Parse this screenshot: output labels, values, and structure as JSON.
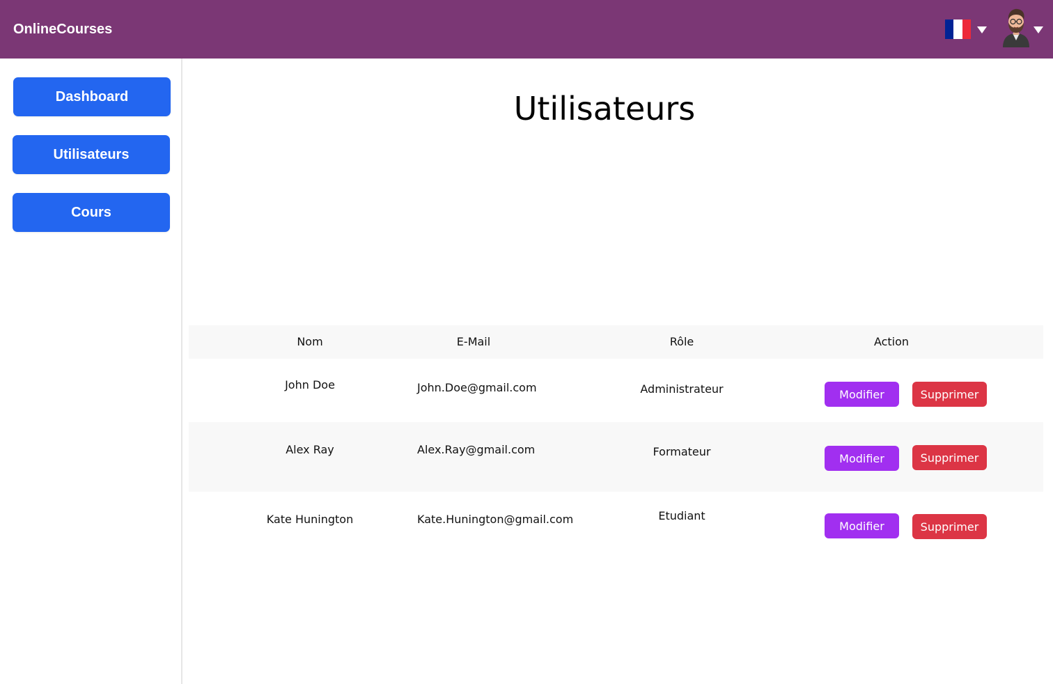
{
  "header": {
    "brand": "OnlineCourses",
    "language_flag": {
      "name": "france-flag",
      "colors": [
        "#002395",
        "#ffffff",
        "#ed2939"
      ]
    },
    "avatar": "user-avatar-icon"
  },
  "sidebar": {
    "items": [
      {
        "label": "Dashboard"
      },
      {
        "label": "Utilisateurs"
      },
      {
        "label": "Cours"
      }
    ]
  },
  "main": {
    "title": "Utilisateurs",
    "table": {
      "columns": [
        "Nom",
        "E-Mail",
        "Rôle",
        "Action"
      ],
      "rows": [
        {
          "nom": "John Doe",
          "email": "John.Doe@gmail.com",
          "role": "Administrateur",
          "edit": "Modifier",
          "delete": "Supprimer"
        },
        {
          "nom": "Alex Ray",
          "email": "Alex.Ray@gmail.com",
          "role": "Formateur",
          "edit": "Modifier",
          "delete": "Supprimer"
        },
        {
          "nom": "Kate Hunington",
          "email": "Kate.Hunington@gmail.com",
          "role": "Etudiant",
          "edit": "Modifier",
          "delete": "Supprimer"
        }
      ]
    }
  },
  "colors": {
    "topbar": "#7b3775",
    "nav_button": "#2366f0",
    "edit_button": "#a12ff0",
    "delete_button": "#dc3545",
    "table_stripe": "#f8f8f8"
  }
}
